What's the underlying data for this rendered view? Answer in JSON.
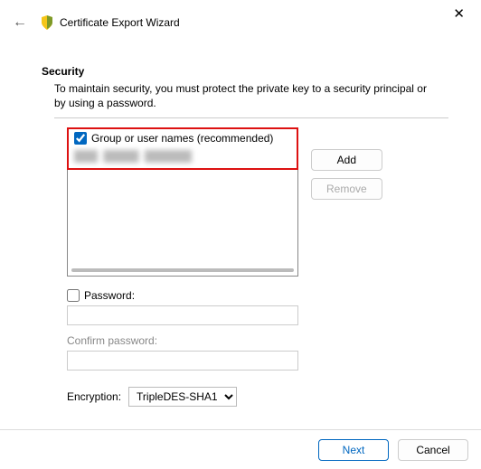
{
  "window": {
    "title": "Certificate Export Wizard",
    "close_glyph": "✕",
    "back_glyph": "←"
  },
  "heading": "Security",
  "description": "To maintain security, you must protect the private key to a security principal or by using a password.",
  "group_names": {
    "checkbox_label": "Group or user names (recommended)",
    "checked": true,
    "items": [
      "redacted-entry"
    ]
  },
  "buttons": {
    "add": "Add",
    "remove": "Remove"
  },
  "password": {
    "checkbox_label": "Password:",
    "checked": false,
    "value": "",
    "confirm_label": "Confirm password:",
    "confirm_value": ""
  },
  "encryption": {
    "label": "Encryption:",
    "selected": "TripleDES-SHA1",
    "options": [
      "TripleDES-SHA1"
    ]
  },
  "footer": {
    "next": "Next",
    "cancel": "Cancel"
  }
}
